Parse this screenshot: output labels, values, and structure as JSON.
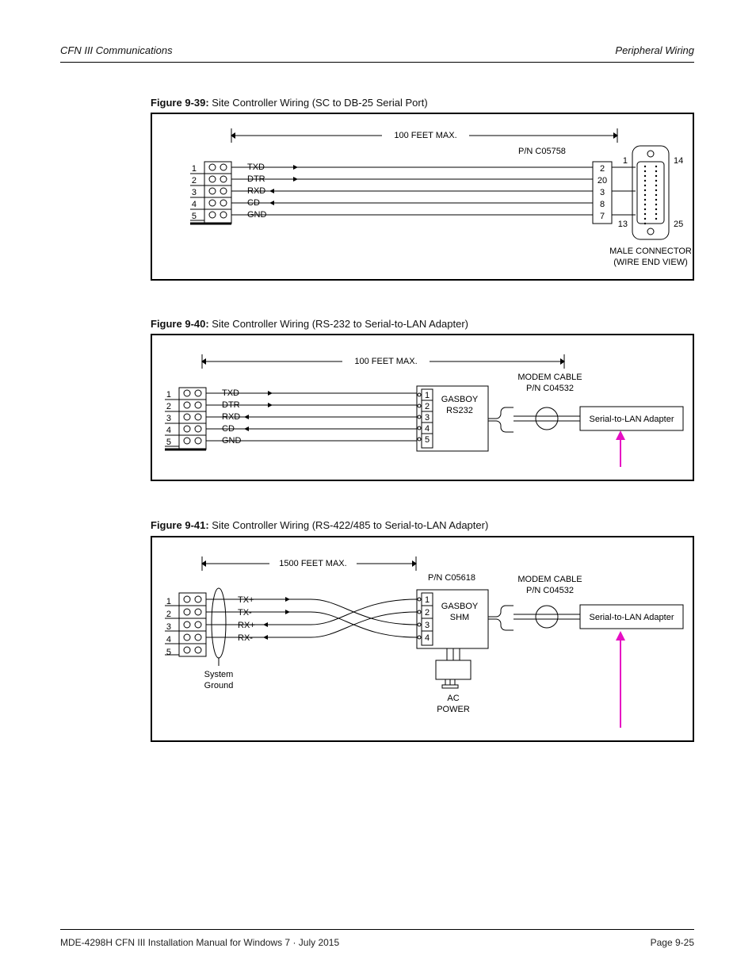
{
  "header": {
    "left": "CFN III Communications",
    "right": "Peripheral Wiring"
  },
  "footer": {
    "left": "MDE-4298H CFN III Installation Manual for Windows 7 · July 2015",
    "version": "",
    "page": "Page 9-25"
  },
  "figures": {
    "f1": {
      "label": "Figure 9-39: ",
      "title": "Site Controller Wiring (SC to DB-25 Serial Port)"
    },
    "f2": {
      "label": "Figure 9-40: ",
      "title": "Site Controller Wiring (RS-232 to Serial-to-LAN Adapter)"
    },
    "f3": {
      "label": "Figure 9-41: ",
      "title": "Site Controller Wiring (RS-422/485 to Serial-to-LAN Adapter)"
    }
  },
  "diag1": {
    "span": "100 FEET MAX.",
    "pn": "P/N C05758",
    "signals": [
      "TXD",
      "DTR",
      "RXD",
      "CD",
      "GND"
    ],
    "left_pins": [
      "1",
      "2",
      "3",
      "4",
      "5"
    ],
    "right_pins": [
      "2",
      "20",
      "3",
      "8",
      "7"
    ],
    "conn_tl": "1",
    "conn_tr": "14",
    "conn_bl": "13",
    "conn_br": "25",
    "conn_cap1": "MALE CONNECTOR",
    "conn_cap2": "(WIRE END VIEW)"
  },
  "diag2": {
    "span": "100 FEET MAX.",
    "signals": [
      "TXD",
      "DTR",
      "RXD",
      "CD",
      "GND"
    ],
    "left_pins": [
      "1",
      "2",
      "3",
      "4",
      "5"
    ],
    "mid_pins": [
      "1",
      "2",
      "3",
      "4",
      "5"
    ],
    "box1_l1": "GASBOY",
    "box1_l2": "RS232",
    "modem_l1": "MODEM CABLE",
    "modem_l2": "P/N C04532",
    "adapter": "Serial-to-LAN Adapter"
  },
  "diag3": {
    "span": "1500 FEET MAX.",
    "pn": "P/N C05618",
    "signals": [
      "TX+",
      "TX-",
      "RX+",
      "RX-"
    ],
    "left_pins": [
      "1",
      "2",
      "3",
      "4",
      "5"
    ],
    "mid_pins": [
      "1",
      "2",
      "3",
      "4"
    ],
    "box1_l1": "GASBOY",
    "box1_l2": "SHM",
    "modem_l1": "MODEM CABLE",
    "modem_l2": "P/N C04532",
    "adapter": "Serial-to-LAN Adapter",
    "sysgnd_l1": "System",
    "sysgnd_l2": "Ground",
    "ac_l1": "AC",
    "ac_l2": "POWER"
  }
}
